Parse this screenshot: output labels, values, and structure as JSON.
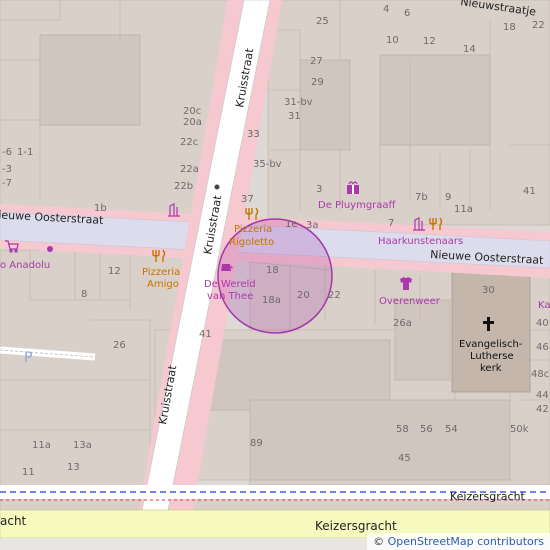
{
  "streets": {
    "kruisstraat": "Kruisstraat",
    "nieuwe_oosterstraat": "Nieuwe Oosterstraat",
    "keizersgracht": "Keizersgracht",
    "acht_partial": "acht",
    "nieuwstraatje": "Nieuwstraatje"
  },
  "house_numbers": {
    "n4": "4",
    "n6": "6",
    "n25": "25",
    "n10": "10",
    "n12a": "12",
    "n14": "14",
    "n18": "18",
    "n22": "22",
    "n27": "27",
    "n29": "29",
    "n31bv": "31-bv",
    "n31": "31",
    "n33": "33",
    "n35bv": "35-bv",
    "n3": "3",
    "n37": "37",
    "n7b": "7b",
    "n9": "9",
    "n41a": "41",
    "n1e": "1e",
    "n3a": "3a",
    "n7": "7",
    "n11a": "11a",
    "n20c": "20c",
    "n20a": "20a",
    "n22c": "22c",
    "n22a": "22a",
    "n22b": "22b",
    "n1b": "1b",
    "n6_1": "-6",
    "n1_1": "1-1",
    "n3_1": "-3",
    "n7_1": "-7",
    "n18a": "18a",
    "n20": "20",
    "n22b2": "22",
    "n12b": "12",
    "n8": "8",
    "n41b": "41",
    "n26": "26",
    "n26a": "26a",
    "n30": "30",
    "n58": "58",
    "n56": "56",
    "n54": "54",
    "n50k": "50k",
    "n45": "45",
    "n89": "89",
    "n11a2": "11a",
    "n13a": "13a",
    "n11": "11",
    "n13": "13",
    "n48c": "48c",
    "n46": "46",
    "n44": "44",
    "n42": "42",
    "n40": "40"
  },
  "pois": {
    "pizzeria_rigoletto_l1": "Pizzeria",
    "pizzeria_rigoletto_l2": "Rigoletto",
    "pizzeria_amigo_l1": "Pizzeria",
    "pizzeria_amigo_l2": "Amigo",
    "de_wereld_l1": "De Wereld",
    "de_wereld_l2": "van Thee",
    "de_pluymgraaff": "De Pluymgraaff",
    "haarkunstenaars": "Haarkunstenaars",
    "overenweer": "Overenweer",
    "anadolu": "o Anadolu",
    "ka_partial": "Ka",
    "church_l1": "Evangelisch-",
    "church_l2": "Lutherse",
    "church_l3": "kerk"
  },
  "attribution": {
    "copyright": "©",
    "link": "OpenStreetMap contributors"
  },
  "colors": {
    "building": "#d9d0c9",
    "road_pink": "#f6c8cf",
    "road_white": "#ffffff",
    "canal_road": "#f7fabf",
    "church": "#c4b6ab",
    "highlight": "#a337a8",
    "poi_brown": "#c77400",
    "poi_purple": "#ac39ac"
  }
}
